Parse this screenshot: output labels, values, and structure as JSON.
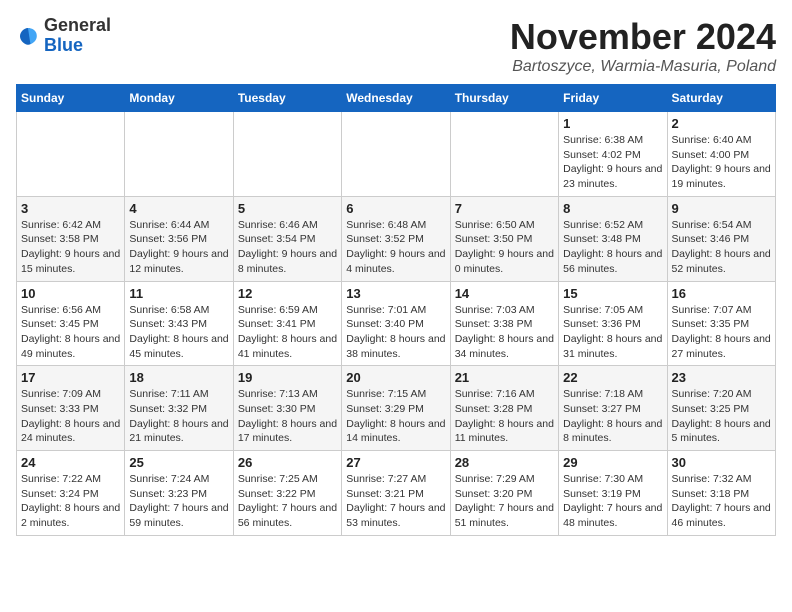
{
  "logo": {
    "general": "General",
    "blue": "Blue"
  },
  "header": {
    "month": "November 2024",
    "location": "Bartoszyce, Warmia-Masuria, Poland"
  },
  "weekdays": [
    "Sunday",
    "Monday",
    "Tuesday",
    "Wednesday",
    "Thursday",
    "Friday",
    "Saturday"
  ],
  "weeks": [
    [
      {
        "day": "",
        "sunrise": "",
        "sunset": "",
        "daylight": ""
      },
      {
        "day": "",
        "sunrise": "",
        "sunset": "",
        "daylight": ""
      },
      {
        "day": "",
        "sunrise": "",
        "sunset": "",
        "daylight": ""
      },
      {
        "day": "",
        "sunrise": "",
        "sunset": "",
        "daylight": ""
      },
      {
        "day": "",
        "sunrise": "",
        "sunset": "",
        "daylight": ""
      },
      {
        "day": "1",
        "sunrise": "Sunrise: 6:38 AM",
        "sunset": "Sunset: 4:02 PM",
        "daylight": "Daylight: 9 hours and 23 minutes."
      },
      {
        "day": "2",
        "sunrise": "Sunrise: 6:40 AM",
        "sunset": "Sunset: 4:00 PM",
        "daylight": "Daylight: 9 hours and 19 minutes."
      }
    ],
    [
      {
        "day": "3",
        "sunrise": "Sunrise: 6:42 AM",
        "sunset": "Sunset: 3:58 PM",
        "daylight": "Daylight: 9 hours and 15 minutes."
      },
      {
        "day": "4",
        "sunrise": "Sunrise: 6:44 AM",
        "sunset": "Sunset: 3:56 PM",
        "daylight": "Daylight: 9 hours and 12 minutes."
      },
      {
        "day": "5",
        "sunrise": "Sunrise: 6:46 AM",
        "sunset": "Sunset: 3:54 PM",
        "daylight": "Daylight: 9 hours and 8 minutes."
      },
      {
        "day": "6",
        "sunrise": "Sunrise: 6:48 AM",
        "sunset": "Sunset: 3:52 PM",
        "daylight": "Daylight: 9 hours and 4 minutes."
      },
      {
        "day": "7",
        "sunrise": "Sunrise: 6:50 AM",
        "sunset": "Sunset: 3:50 PM",
        "daylight": "Daylight: 9 hours and 0 minutes."
      },
      {
        "day": "8",
        "sunrise": "Sunrise: 6:52 AM",
        "sunset": "Sunset: 3:48 PM",
        "daylight": "Daylight: 8 hours and 56 minutes."
      },
      {
        "day": "9",
        "sunrise": "Sunrise: 6:54 AM",
        "sunset": "Sunset: 3:46 PM",
        "daylight": "Daylight: 8 hours and 52 minutes."
      }
    ],
    [
      {
        "day": "10",
        "sunrise": "Sunrise: 6:56 AM",
        "sunset": "Sunset: 3:45 PM",
        "daylight": "Daylight: 8 hours and 49 minutes."
      },
      {
        "day": "11",
        "sunrise": "Sunrise: 6:58 AM",
        "sunset": "Sunset: 3:43 PM",
        "daylight": "Daylight: 8 hours and 45 minutes."
      },
      {
        "day": "12",
        "sunrise": "Sunrise: 6:59 AM",
        "sunset": "Sunset: 3:41 PM",
        "daylight": "Daylight: 8 hours and 41 minutes."
      },
      {
        "day": "13",
        "sunrise": "Sunrise: 7:01 AM",
        "sunset": "Sunset: 3:40 PM",
        "daylight": "Daylight: 8 hours and 38 minutes."
      },
      {
        "day": "14",
        "sunrise": "Sunrise: 7:03 AM",
        "sunset": "Sunset: 3:38 PM",
        "daylight": "Daylight: 8 hours and 34 minutes."
      },
      {
        "day": "15",
        "sunrise": "Sunrise: 7:05 AM",
        "sunset": "Sunset: 3:36 PM",
        "daylight": "Daylight: 8 hours and 31 minutes."
      },
      {
        "day": "16",
        "sunrise": "Sunrise: 7:07 AM",
        "sunset": "Sunset: 3:35 PM",
        "daylight": "Daylight: 8 hours and 27 minutes."
      }
    ],
    [
      {
        "day": "17",
        "sunrise": "Sunrise: 7:09 AM",
        "sunset": "Sunset: 3:33 PM",
        "daylight": "Daylight: 8 hours and 24 minutes."
      },
      {
        "day": "18",
        "sunrise": "Sunrise: 7:11 AM",
        "sunset": "Sunset: 3:32 PM",
        "daylight": "Daylight: 8 hours and 21 minutes."
      },
      {
        "day": "19",
        "sunrise": "Sunrise: 7:13 AM",
        "sunset": "Sunset: 3:30 PM",
        "daylight": "Daylight: 8 hours and 17 minutes."
      },
      {
        "day": "20",
        "sunrise": "Sunrise: 7:15 AM",
        "sunset": "Sunset: 3:29 PM",
        "daylight": "Daylight: 8 hours and 14 minutes."
      },
      {
        "day": "21",
        "sunrise": "Sunrise: 7:16 AM",
        "sunset": "Sunset: 3:28 PM",
        "daylight": "Daylight: 8 hours and 11 minutes."
      },
      {
        "day": "22",
        "sunrise": "Sunrise: 7:18 AM",
        "sunset": "Sunset: 3:27 PM",
        "daylight": "Daylight: 8 hours and 8 minutes."
      },
      {
        "day": "23",
        "sunrise": "Sunrise: 7:20 AM",
        "sunset": "Sunset: 3:25 PM",
        "daylight": "Daylight: 8 hours and 5 minutes."
      }
    ],
    [
      {
        "day": "24",
        "sunrise": "Sunrise: 7:22 AM",
        "sunset": "Sunset: 3:24 PM",
        "daylight": "Daylight: 8 hours and 2 minutes."
      },
      {
        "day": "25",
        "sunrise": "Sunrise: 7:24 AM",
        "sunset": "Sunset: 3:23 PM",
        "daylight": "Daylight: 7 hours and 59 minutes."
      },
      {
        "day": "26",
        "sunrise": "Sunrise: 7:25 AM",
        "sunset": "Sunset: 3:22 PM",
        "daylight": "Daylight: 7 hours and 56 minutes."
      },
      {
        "day": "27",
        "sunrise": "Sunrise: 7:27 AM",
        "sunset": "Sunset: 3:21 PM",
        "daylight": "Daylight: 7 hours and 53 minutes."
      },
      {
        "day": "28",
        "sunrise": "Sunrise: 7:29 AM",
        "sunset": "Sunset: 3:20 PM",
        "daylight": "Daylight: 7 hours and 51 minutes."
      },
      {
        "day": "29",
        "sunrise": "Sunrise: 7:30 AM",
        "sunset": "Sunset: 3:19 PM",
        "daylight": "Daylight: 7 hours and 48 minutes."
      },
      {
        "day": "30",
        "sunrise": "Sunrise: 7:32 AM",
        "sunset": "Sunset: 3:18 PM",
        "daylight": "Daylight: 7 hours and 46 minutes."
      }
    ]
  ]
}
